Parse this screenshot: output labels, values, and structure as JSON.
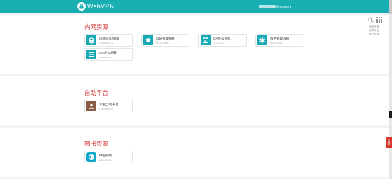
{
  "topbar": {
    "logo_text": "WebVPN",
    "user_suffix": "@ecnup",
    "user_caret": "▾",
    "accent": "#18aeb2"
  },
  "tools": {
    "search_icon": "search-icon",
    "grid_icon": "grid-icon"
  },
  "side_links": [
    "内网资源",
    "自助平台",
    "图书资源"
  ],
  "sections": [
    {
      "title": "内网资源",
      "cards": [
        {
          "name": "内网浏览WEB",
          "sub": "172.16.100.11",
          "icon": "browser-icon",
          "color": "#16aab5"
        },
        {
          "name": "科研管理系统",
          "sub": "172.16.100.5",
          "icon": "graduation-cap-icon",
          "color": "#16aab5"
        },
        {
          "name": "OA办公总机",
          "sub": "oa.ecnu.cn",
          "icon": "calendar-check-icon",
          "color": "#16aab5"
        },
        {
          "name": "教务管理系统",
          "sub": "172.16.100.3",
          "icon": "asterisk-icon",
          "color": "#16aab5"
        },
        {
          "name": "OA办公邮箱",
          "sub": "mail.ecnu.cn",
          "icon": "list-icon",
          "color": "#16aab5"
        }
      ]
    },
    {
      "title": "自助平台",
      "cards": [
        {
          "name": "学生自助平台",
          "sub": "172.16.100.10",
          "icon": "user-portrait-icon",
          "color": "#8c5b45"
        }
      ]
    },
    {
      "title": "图书资源",
      "cards": [
        {
          "name": "中国知网",
          "sub": "www.cnki.net",
          "icon": "cnki-icon",
          "color": "#0aa7c8"
        }
      ]
    }
  ],
  "float_tab": "反馈"
}
